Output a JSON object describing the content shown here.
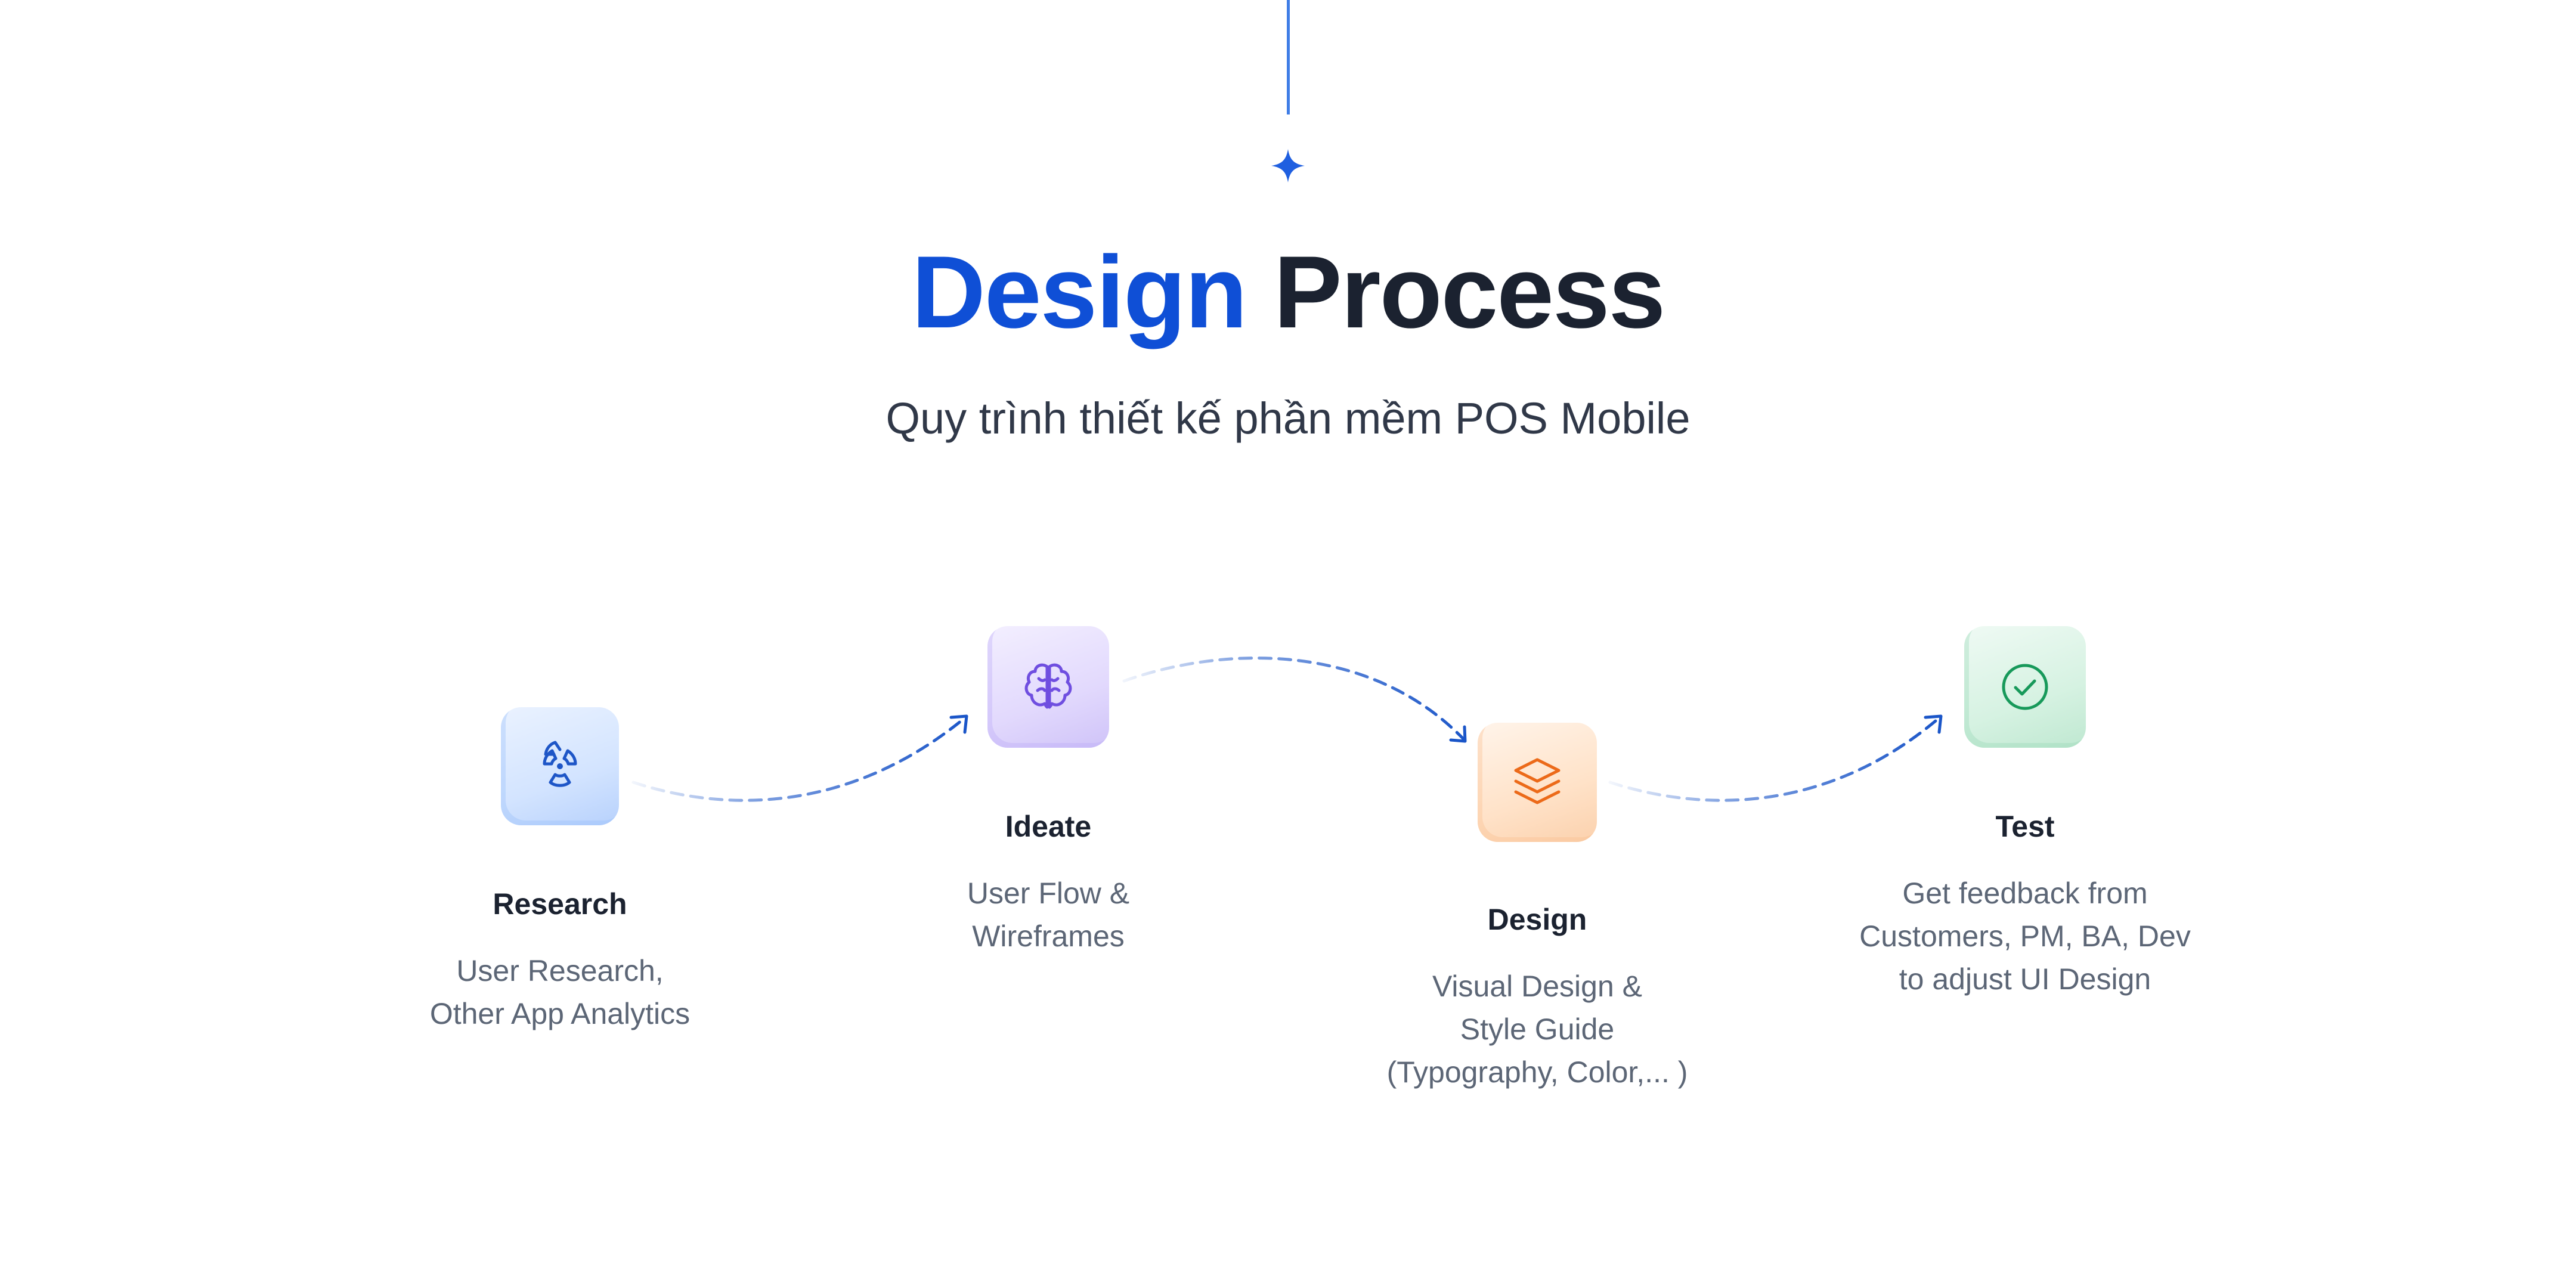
{
  "header": {
    "title_accent": "Design",
    "title_main": "Process",
    "subtitle": "Quy trình thiết kế phần mềm POS Mobile"
  },
  "colors": {
    "accent": "#0f4fd6",
    "dark": "#1b2230",
    "connector": "#1a55c8",
    "research": "#1e56c7",
    "ideate": "#6f4ee0",
    "design": "#ec6a19",
    "test": "#17995a"
  },
  "steps": [
    {
      "id": "research",
      "icon": "radiation-icon",
      "title": "Research",
      "desc": [
        "User Research,",
        "Other App Analytics"
      ]
    },
    {
      "id": "ideate",
      "icon": "brain-icon",
      "title": "Ideate",
      "desc": [
        "User Flow &",
        "Wireframes"
      ]
    },
    {
      "id": "design",
      "icon": "layers-icon",
      "title": "Design",
      "desc": [
        "Visual Design &",
        "Style Guide",
        "(Typography, Color,... )"
      ]
    },
    {
      "id": "test",
      "icon": "check-circle-icon",
      "title": "Test",
      "desc": [
        "Get feedback from",
        "Customers, PM, BA, Dev",
        "to adjust UI Design"
      ]
    }
  ]
}
